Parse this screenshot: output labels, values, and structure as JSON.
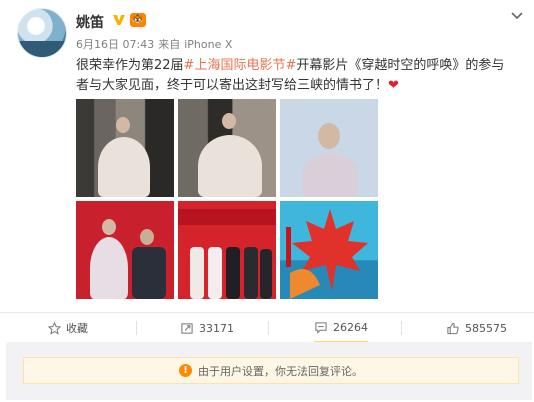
{
  "post": {
    "author": "姚笛",
    "vip_badge": "🐯",
    "date": "6月16日 07:43",
    "source_prefix": "来自",
    "source": "iPhone X",
    "text_before": "很荣幸作为第22届",
    "topic": "#上海国际电影节#",
    "text_after": "开幕影片《穿越时空的呼唤》的参与者与大家见面，终于可以寄出这封写给三峡的情书了！",
    "heart": "❤"
  },
  "actions": {
    "favorite_label": "收藏",
    "repost_count": "33171",
    "comment_count": "26264",
    "like_count": "585575"
  },
  "notice": {
    "text": "由于用户设置，你无法回复评论。",
    "icon_glyph": "!"
  },
  "icons": [
    "verified-v-icon",
    "chevron-down-icon",
    "star-icon",
    "repost-icon",
    "comment-icon",
    "thumbs-up-icon",
    "warning-icon"
  ],
  "colors": {
    "topic": "#eb7350",
    "vip": "#ff8200",
    "warning": "#ff8a00",
    "verified": "#f4b400"
  }
}
